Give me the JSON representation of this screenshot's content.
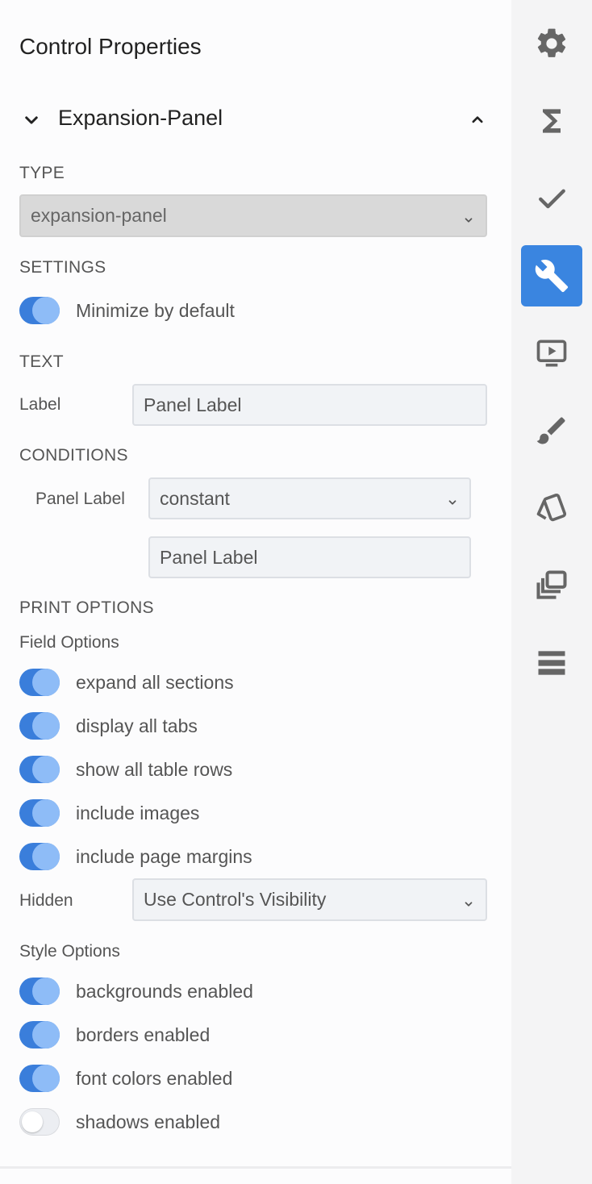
{
  "header": {
    "title": "Control Properties"
  },
  "expansion": {
    "title": "Expansion-Panel"
  },
  "type_section": {
    "heading": "TYPE",
    "selected": "expansion-panel"
  },
  "settings": {
    "heading": "SETTINGS",
    "minimize_label": "Minimize by default",
    "minimize_on": true
  },
  "text_section": {
    "heading": "TEXT",
    "label_field_label": "Label",
    "label_value": "Panel Label"
  },
  "conditions": {
    "heading": "CONDITIONS",
    "field_label": "Panel Label",
    "mode_selected": "constant",
    "value": "Panel Label"
  },
  "print_options": {
    "heading": "PRINT OPTIONS",
    "field_options_label": "Field Options",
    "field_toggles": [
      {
        "label": "expand all sections",
        "on": true
      },
      {
        "label": "display all tabs",
        "on": true
      },
      {
        "label": "show all table rows",
        "on": true
      },
      {
        "label": "include images",
        "on": true
      },
      {
        "label": "include page margins",
        "on": true
      }
    ],
    "hidden_label": "Hidden",
    "hidden_selected": "Use Control's Visibility",
    "style_options_label": "Style Options",
    "style_toggles": [
      {
        "label": "backgrounds enabled",
        "on": true
      },
      {
        "label": "borders enabled",
        "on": true
      },
      {
        "label": "font colors enabled",
        "on": true
      },
      {
        "label": "shadows enabled",
        "on": false
      }
    ]
  },
  "rail": {
    "icons": [
      "gear-icon",
      "sigma-icon",
      "check-icon",
      "wrench-icon",
      "video-play-icon",
      "brush-icon",
      "cards-icon",
      "stack-icon",
      "list-icon"
    ],
    "active": "wrench-icon"
  },
  "colors": {
    "accent": "#3a85e0",
    "toggle_on": "#3a7edb",
    "toggle_knob": "#8ebcf7",
    "icon": "#666666"
  }
}
